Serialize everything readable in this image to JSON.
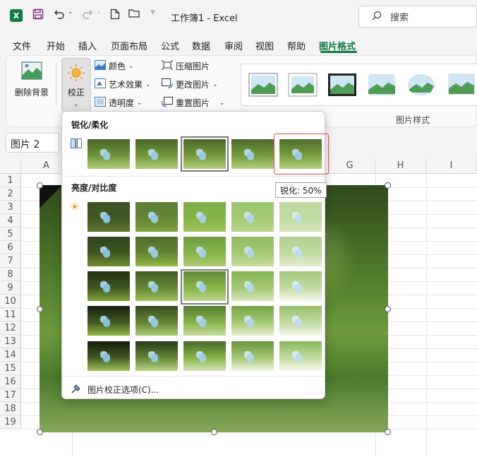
{
  "titlebar": {
    "app_icon": "X",
    "title": "工作簿1  -  Excel",
    "search_placeholder": "搜索"
  },
  "menu": {
    "items": [
      "文件",
      "开始",
      "插入",
      "页面布局",
      "公式",
      "数据",
      "审阅",
      "视图",
      "帮助",
      "图片格式"
    ],
    "active_index": 9
  },
  "ribbon": {
    "remove_bg": "删除背景",
    "corrections": "校正",
    "color": "颜色",
    "artistic": "艺术效果",
    "transparency": "透明度",
    "compress": "压缩图片",
    "change": "更改图片",
    "reset": "重置图片",
    "styles_group": "图片样式"
  },
  "namebox": {
    "value": "图片 2"
  },
  "sheet": {
    "columns": [
      "A",
      "G",
      "H",
      "I"
    ],
    "rows": [
      "1",
      "2",
      "3",
      "4",
      "5",
      "6",
      "7",
      "8",
      "9",
      "10",
      "11",
      "12",
      "13",
      "14",
      "15",
      "16",
      "17",
      "18",
      "19"
    ]
  },
  "dropdown": {
    "sharpen_title": "锐化/柔化",
    "brightness_title": "亮度/对比度",
    "footer": "图片校正选项(C)...",
    "tooltip": "锐化: 50%"
  },
  "colors": {
    "accent": "#107c41",
    "highlight": "#e04b4b"
  }
}
